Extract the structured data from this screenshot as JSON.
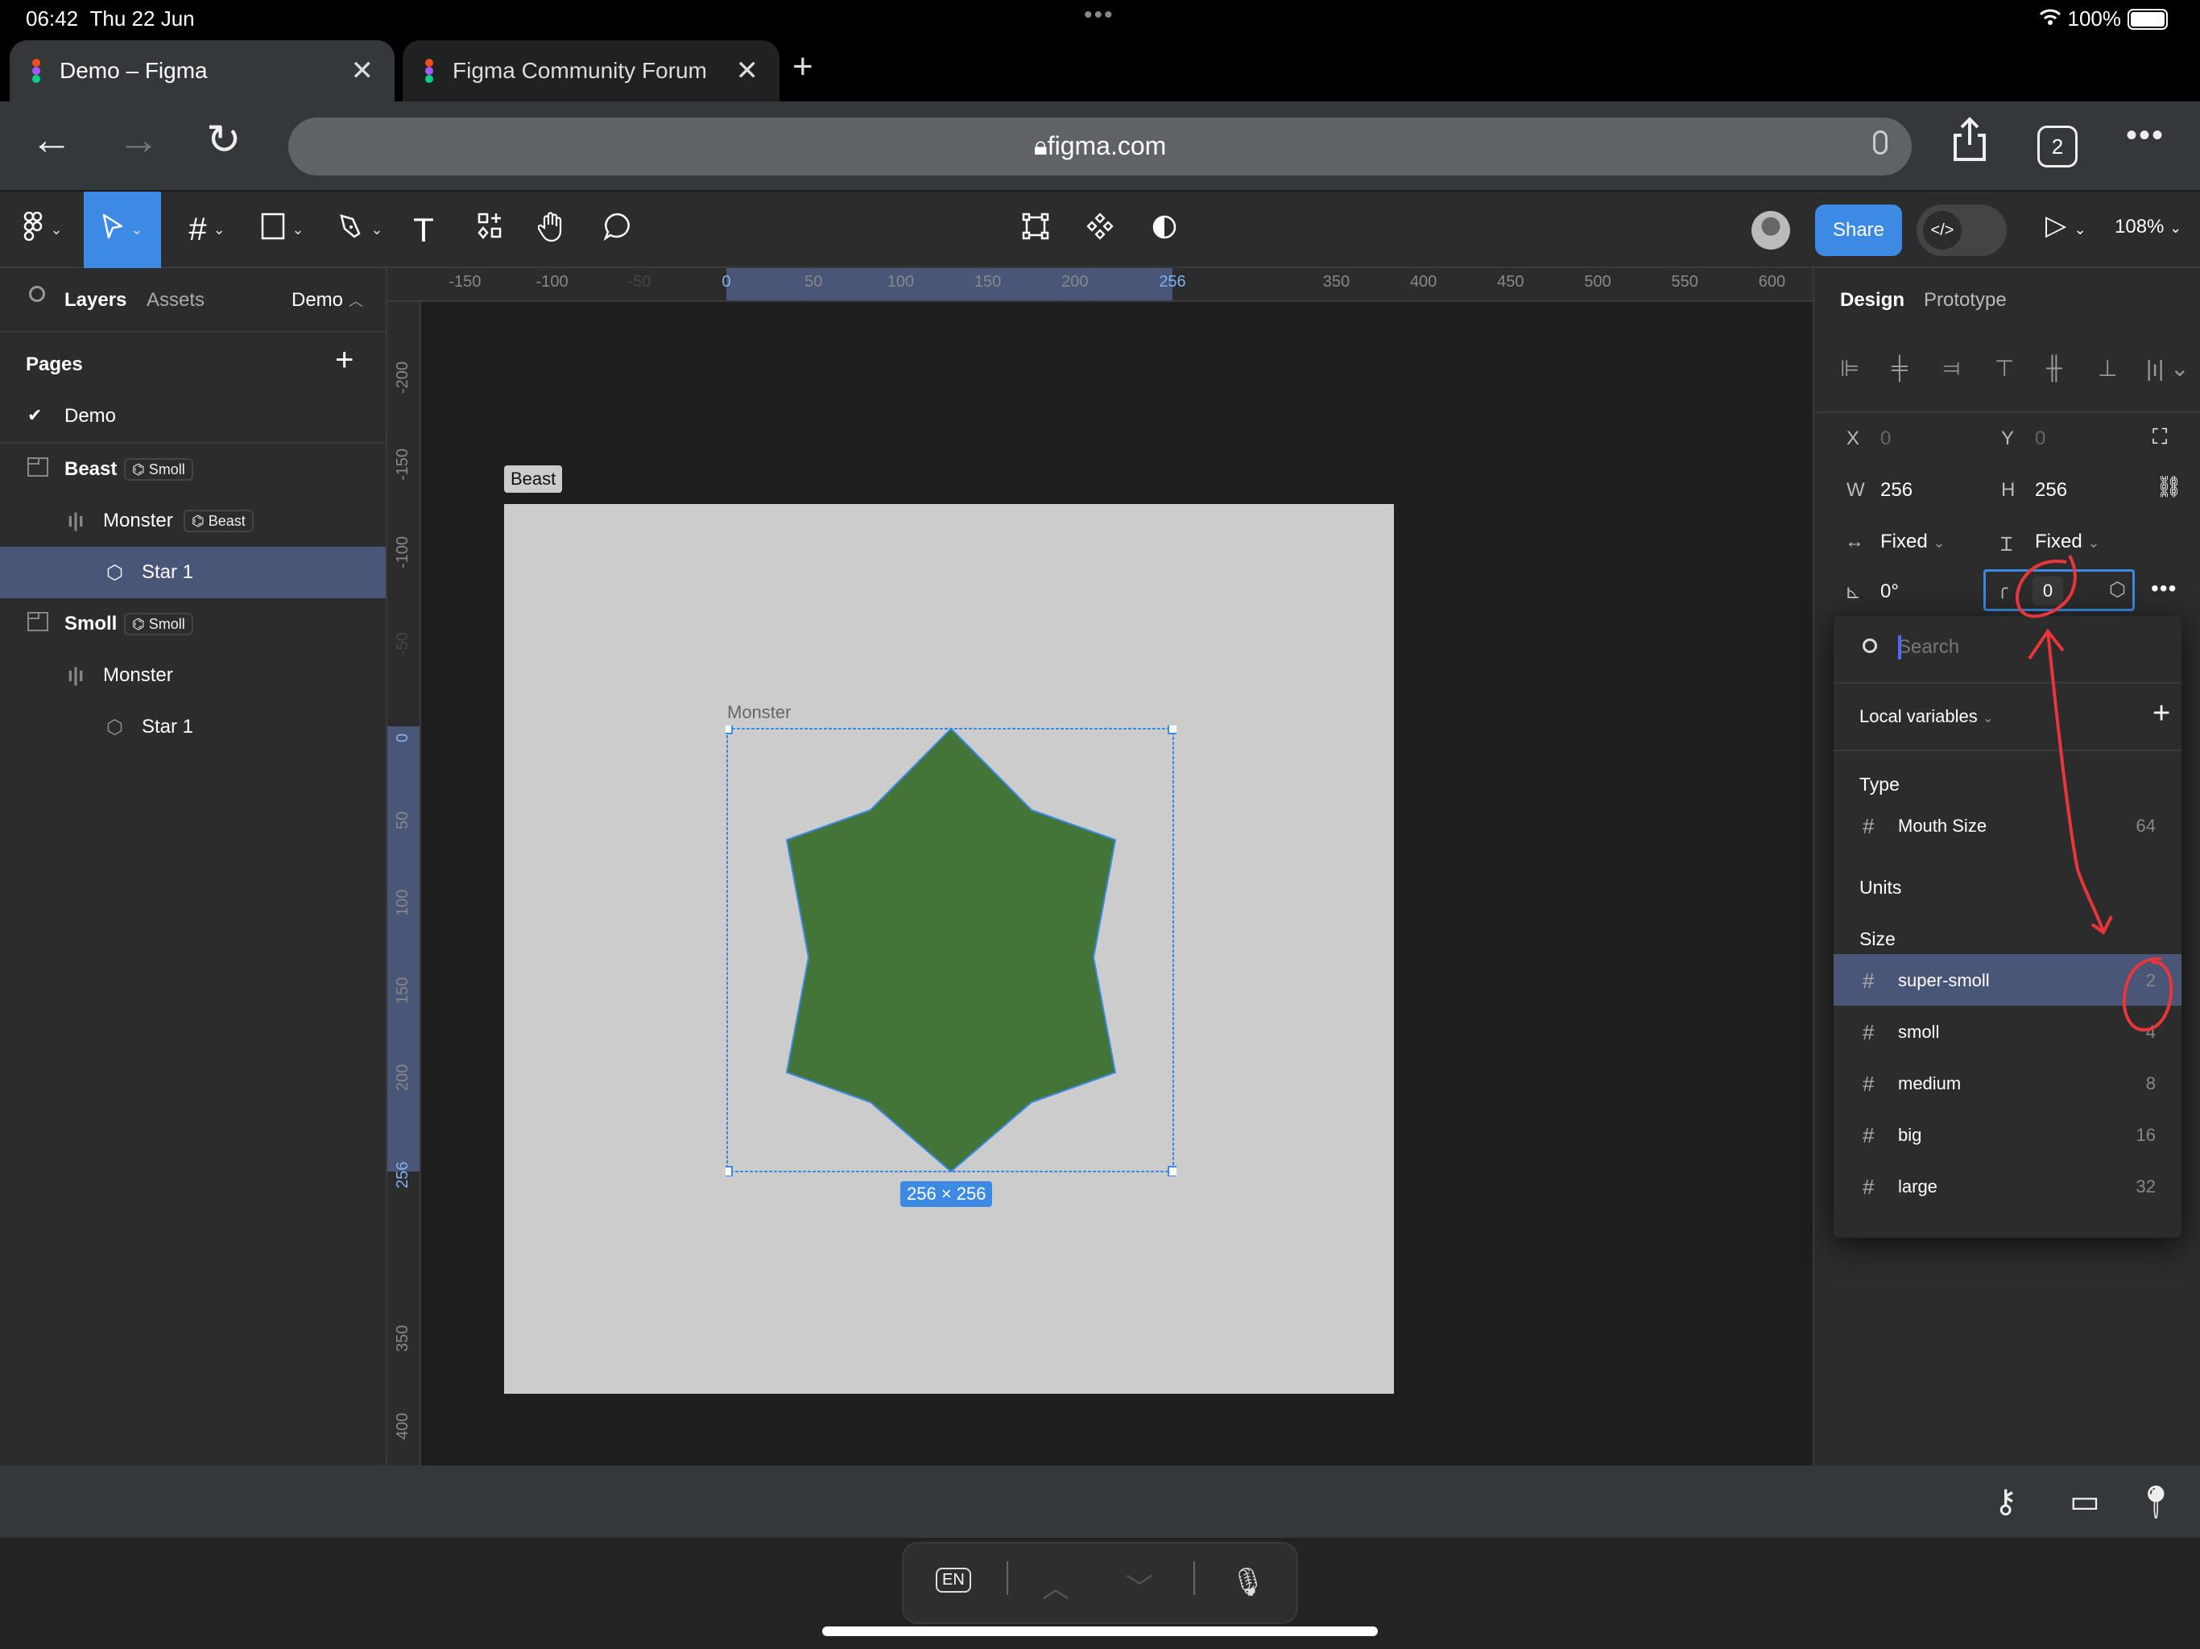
{
  "status_bar": {
    "time": "06:42",
    "date": "Thu 22 Jun",
    "battery": "100%"
  },
  "browser": {
    "tabs": [
      {
        "title": "Demo – Figma",
        "active": true
      },
      {
        "title": "Figma Community Forum",
        "active": false
      }
    ],
    "url": "figma.com",
    "tab_count": "2"
  },
  "toolbar": {
    "tools": [
      "main-menu",
      "move",
      "frame",
      "rectangle",
      "pen",
      "text",
      "resources",
      "hand",
      "comment"
    ],
    "center_tools": [
      "edit-object",
      "component",
      "mask"
    ],
    "share_label": "Share",
    "dev_mode_label": "</>",
    "zoom": "108%"
  },
  "left_panel": {
    "tabs": {
      "layers": "Layers",
      "assets": "Assets"
    },
    "current_page": "Demo",
    "pages_header": "Pages",
    "pages": [
      {
        "name": "Demo",
        "selected": true
      }
    ],
    "layers": [
      {
        "name": "Beast",
        "type": "frame",
        "badge": "Smoll",
        "depth": 0,
        "selected": false
      },
      {
        "name": "Monster",
        "type": "autolayout",
        "badge": "Beast",
        "depth": 1,
        "selected": false
      },
      {
        "name": "Star 1",
        "type": "star",
        "badge": "",
        "depth": 2,
        "selected": true
      },
      {
        "name": "Smoll",
        "type": "frame",
        "badge": "Smoll",
        "depth": 0,
        "selected": false
      },
      {
        "name": "Monster",
        "type": "autolayout",
        "badge": "",
        "depth": 1,
        "selected": false
      },
      {
        "name": "Star 1",
        "type": "star",
        "badge": "",
        "depth": 2,
        "selected": false
      }
    ]
  },
  "rulers": {
    "horizontal": [
      "-150",
      "-100",
      "-50",
      "0",
      "50",
      "100",
      "150",
      "200",
      "256",
      "350",
      "400",
      "450",
      "500",
      "550",
      "600"
    ],
    "vertical": [
      "-200",
      "-150",
      "-100",
      "-50",
      "0",
      "50",
      "100",
      "150",
      "200",
      "256",
      "350",
      "400"
    ]
  },
  "canvas": {
    "frame_label": "Beast",
    "selection_label": "Monster",
    "dimensions": "256 × 256",
    "star_color": "#437539",
    "frame_color": "#cccccc",
    "selection_color": "#3d8ae4"
  },
  "right_panel": {
    "tabs": {
      "design": "Design",
      "prototype": "Prototype"
    },
    "x_label": "X",
    "x": "0",
    "y_label": "Y",
    "y": "0",
    "w_label": "W",
    "w": "256",
    "h_label": "H",
    "h": "256",
    "width_mode": "Fixed",
    "height_mode": "Fixed",
    "rotation": "0°",
    "corner_radius": "0"
  },
  "variable_picker": {
    "search_placeholder": "Search",
    "collection": "Local variables",
    "groups": [
      {
        "name": "Type",
        "items": [
          {
            "name": "Mouth Size",
            "value": "64"
          }
        ]
      },
      {
        "name": "Units",
        "items": []
      },
      {
        "name": "Size",
        "items": [
          {
            "name": "super-smoll",
            "value": "2",
            "highlighted": true
          },
          {
            "name": "smoll",
            "value": "4"
          },
          {
            "name": "medium",
            "value": "8"
          },
          {
            "name": "big",
            "value": "16"
          },
          {
            "name": "large",
            "value": "32"
          }
        ]
      }
    ]
  },
  "keyboard_bar": {
    "language": "EN"
  }
}
